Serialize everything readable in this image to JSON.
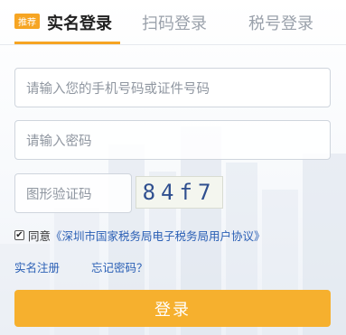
{
  "tabs": {
    "badge": "推荐",
    "realname": "实名登录",
    "scan": "扫码登录",
    "tax": "税号登录"
  },
  "form": {
    "phone_placeholder": "请输入您的手机号码或证件号码",
    "password_placeholder": "请输入密码",
    "captcha_placeholder": "图形验证码",
    "captcha_text": "84f7"
  },
  "agreement": {
    "checked": true,
    "prefix": "同意",
    "link": "《深圳市国家税务局电子税务局用户协议》"
  },
  "links": {
    "register": "实名注册",
    "forgot": "忘记密码？"
  },
  "login_button": "登录",
  "colors": {
    "accent": "#f6a523",
    "button": "#f6b02e",
    "link": "#2a5fb5"
  }
}
